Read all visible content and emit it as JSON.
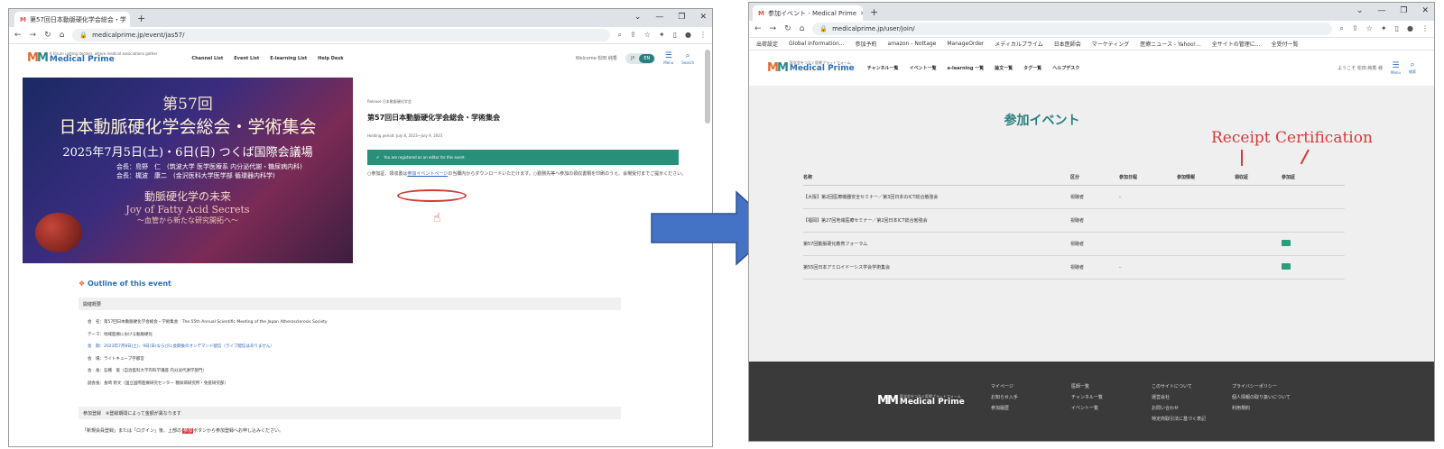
{
  "left": {
    "tab_title": "第57回日本動脈硬化学会総会・学",
    "new_tab": "+",
    "url": "medicalprime.jp/event/jas57/",
    "logo": {
      "tagline": "A forum uniting doctors, where medical associations gather",
      "name": "Medical Prime"
    },
    "nav": [
      "Channel List",
      "Event List",
      "E-learning List",
      "Help Desk"
    ],
    "welcome": "Welcome 松田 純香",
    "lang": [
      "JP",
      "EN"
    ],
    "menu_label": "Menu",
    "search_label": "Search",
    "banner": {
      "line1": "第57回",
      "line2": "日本動脈硬化学会総会・学術集会",
      "line3": "2025年7月5日(土)・6日(日) つくば国際会議場",
      "line4": "会長：島野　仁　(筑波大学 医学医療系 内分泌代謝・糖尿病内科)",
      "line5": "会長：梶波　康二　(金沢医科大学医学部 循環器内科学)",
      "line6": "動脈硬化学の未来",
      "line7": "Joy of Fatty Acid Secrets",
      "line8": "～血管から新たな研究開拓へ～"
    },
    "event": {
      "organizer": "Release 日本動脈硬化学会",
      "title": "第57回日本動脈硬化学会総会・学術集会",
      "period": "Holding period: July 8, 2023〜July 9, 2023",
      "registered": "You are registered as an editor for this event.",
      "note_before": "○参加証、領収書は",
      "note_link": "参加イベントページ",
      "note_after": "の当欄内からダウンロードいただけます。○勤務先等へ参加の領収書類を印刷のうえ、会場受付までご提示ください。"
    },
    "outline_title": "Outline of this event",
    "section1": "開催概要",
    "outline_items": [
      {
        "text": "会　名：第57回日本動脈硬化学会総会・学術集会　The 55th Annual Scientific Meeting of the Japan Atherosclerosis Society",
        "hl": false
      },
      {
        "text": "テーマ：地域医療における動脈硬化",
        "hl": false
      },
      {
        "text": "会　期：2023年7月8日(土)、9日(日)ならびに会期後のオンデマンド配信（ライブ配信はありません）",
        "hl": true
      },
      {
        "text": "会　場：ライトキューブ宇都宮",
        "hl": false
      },
      {
        "text": "会　長：石橋　俊（自治医科大学内科学講座 内分泌代謝学部門）",
        "hl": false
      },
      {
        "text": "副会長：長崎 修文（国立国際医療研究センター 糖尿病研究所・免疫研究部）",
        "hl": false
      }
    ],
    "section2": "参加登録　※登録期間によって金額が異なります",
    "reg_note_before": "「新規会員登録」または「ログイン」後、上部の",
    "reg_note_mark": "参加",
    "reg_note_after": "ボタンから参加登録へお申し込みください。"
  },
  "right": {
    "tab_title": "参加イベント - Medical Prime",
    "new_tab": "+",
    "url": "medicalprime.jp/user/join/",
    "bookmarks": [
      "出荷設定",
      "Global Information...",
      "参加予約",
      "amazon - Nottage",
      "ManageOrder",
      "メディカルプライム",
      "日本医師会",
      "マーケティング",
      "医療ニュース - Yahoo!...",
      "全サイトの管理に...",
      "全受付一覧"
    ],
    "logo": {
      "tagline": "医学会をつなぐ医療プラットフォーム",
      "name": "Medical Prime"
    },
    "nav": [
      "チャンネル一覧",
      "イベント一覧",
      "e-learning 一覧",
      "論文一覧",
      "タグ一覧",
      "ヘルプデスク"
    ],
    "welcome": "ようこそ 松田 純香 様",
    "menu_label": "Menu",
    "search_label": "検索",
    "page_title": "参加イベント",
    "annotation": "Receipt Certification",
    "columns": [
      "名称",
      "区分",
      "参加日程",
      "参加情報",
      "領収証",
      "参加証"
    ],
    "rows": [
      {
        "name": "【大阪】第2回医療機器安全セミナー／第3回日本のICT総合勉強会",
        "type": "視聴者",
        "date": "-",
        "info": "",
        "receipt": false,
        "cert": false
      },
      {
        "name": "【福岡】第27回地域医療セミナー／第2回日本ICT総合勉強会",
        "type": "視聴者",
        "date": "",
        "info": "",
        "receipt": false,
        "cert": false
      },
      {
        "name": "第57回動脈硬化教育フォーラム",
        "type": "視聴者",
        "date": "",
        "info": "",
        "receipt": false,
        "cert": true
      },
      {
        "name": "第55回日本アミロイドーシス学会学術集会",
        "type": "視聴者",
        "date": "-",
        "info": "",
        "receipt": false,
        "cert": true
      }
    ],
    "footer": {
      "logo_tagline": "医学会をつなぐ医療プラットフォーム",
      "logo_name": "Medical Prime",
      "col1": [
        "マイページ",
        "お知らせ入手",
        "参加履歴"
      ],
      "col2": [
        "医師一覧",
        "チャンネル一覧",
        "イベント一覧"
      ],
      "col3": [
        "このサイトについて",
        "運営会社",
        "お問い合わせ",
        "特定商取引法に基づく表記"
      ],
      "col4": [
        "プライバシーポリシー",
        "個人情報の取り扱いについて",
        "利用規約"
      ]
    }
  },
  "colors": {
    "accent": "#2a7f7d",
    "arrow": "#4472c4",
    "annotation": "#d43a3a"
  }
}
